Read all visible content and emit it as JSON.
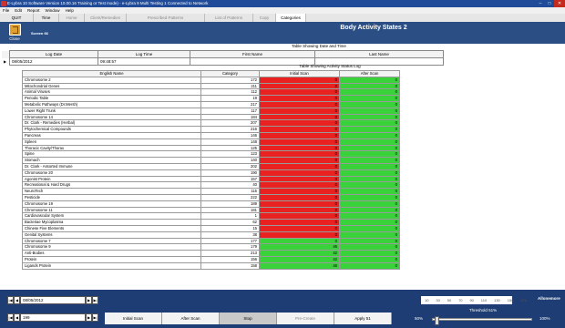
{
  "window": {
    "title": "E-Lybra 10 Software Version 10.00.16 Training or Test mode) - e-Lybra 9 Multi Testing 1 Connected to Network"
  },
  "menu": [
    "File",
    "Edit",
    "Report",
    "Window",
    "Help"
  ],
  "tabs": [
    {
      "label": "QUIT",
      "state": "normal"
    },
    {
      "label": "Time",
      "state": "normal"
    },
    {
      "label": "Home",
      "state": "disabled"
    },
    {
      "label": "Client/Remedies",
      "state": "disabled"
    },
    {
      "label": "Prescribed Patterns",
      "state": "disabled"
    },
    {
      "label": "List of Patterns",
      "state": "disabled"
    },
    {
      "label": "Copy",
      "state": "disabled"
    },
    {
      "label": "Categories",
      "state": "normal"
    }
  ],
  "header": {
    "close_label": "Close",
    "screen_id": "Screen 66",
    "title": "Body Activity States 2"
  },
  "date_section": {
    "caption": "Table Showing Date and Time",
    "headers": [
      "Log Date",
      "Log Time",
      "First Name",
      "Last Name"
    ],
    "row": [
      "08/05/2012",
      "09:48:57",
      "",
      ""
    ]
  },
  "status_section": {
    "caption": "Table Showing Activity Status Log",
    "headers": [
      "English Name",
      "Category",
      "Initial Scan",
      "After Scan"
    ],
    "rows": [
      {
        "name": "Chromosome 2",
        "cat": "172",
        "init": "0",
        "init_color": "red",
        "after": "0",
        "after_color": "green"
      },
      {
        "name": "Mitochondrial Genes",
        "cat": "211",
        "init": "0",
        "init_color": "red",
        "after": "0",
        "after_color": "green"
      },
      {
        "name": "Animal Viruses",
        "cat": "112",
        "init": "0",
        "init_color": "red",
        "after": "0",
        "after_color": "green"
      },
      {
        "name": "Periodic Table",
        "cat": "19",
        "init": "0",
        "init_color": "red",
        "after": "0",
        "after_color": "green"
      },
      {
        "name": "Metabolic Pathways (Dr.Mersh)",
        "cat": "217",
        "init": "0",
        "init_color": "red",
        "after": "0",
        "after_color": "green"
      },
      {
        "name": "Lower Right Trunk",
        "cat": "117",
        "init": "0",
        "init_color": "red",
        "after": "0",
        "after_color": "green"
      },
      {
        "name": "Chromosome 14",
        "cat": "184",
        "init": "0",
        "init_color": "red",
        "after": "0",
        "after_color": "green"
      },
      {
        "name": "Dr. Clark - Remedies (Herbal)",
        "cat": "207",
        "init": "0",
        "init_color": "red",
        "after": "0",
        "after_color": "green"
      },
      {
        "name": "Phytochemical Compounds",
        "cat": "216",
        "init": "0",
        "init_color": "red",
        "after": "0",
        "after_color": "green"
      },
      {
        "name": "Pancreas",
        "cat": "146",
        "init": "0",
        "init_color": "red",
        "after": "0",
        "after_color": "green"
      },
      {
        "name": "Spleen",
        "cat": "148",
        "init": "0",
        "init_color": "red",
        "after": "0",
        "after_color": "green"
      },
      {
        "name": "Thoracic Cavity/Thorax",
        "cat": "125",
        "init": "0",
        "init_color": "red",
        "after": "0",
        "after_color": "green"
      },
      {
        "name": "Spine",
        "cat": "123",
        "init": "0",
        "init_color": "red",
        "after": "0",
        "after_color": "green"
      },
      {
        "name": "Stomach",
        "cat": "140",
        "init": "0",
        "init_color": "red",
        "after": "0",
        "after_color": "green"
      },
      {
        "name": "Dr. Clark - Assorted Immune",
        "cat": "202",
        "init": "0",
        "init_color": "red",
        "after": "0",
        "after_color": "green"
      },
      {
        "name": "Chromosome 20",
        "cat": "190",
        "init": "0",
        "init_color": "red",
        "after": "0",
        "after_color": "green"
      },
      {
        "name": "Agonist Protein",
        "cat": "157",
        "init": "0",
        "init_color": "red",
        "after": "0",
        "after_color": "green"
      },
      {
        "name": "Recreational & Hard Drugs",
        "cat": "40",
        "init": "0",
        "init_color": "red",
        "after": "0",
        "after_color": "green"
      },
      {
        "name": "NeuroTech",
        "cat": "115",
        "init": "0",
        "init_color": "red",
        "after": "0",
        "after_color": "green"
      },
      {
        "name": "Pesticide",
        "cat": "222",
        "init": "0",
        "init_color": "red",
        "after": "0",
        "after_color": "green"
      },
      {
        "name": "Chromosome 19",
        "cat": "189",
        "init": "0",
        "init_color": "red",
        "after": "0",
        "after_color": "green"
      },
      {
        "name": "Chromosome 11",
        "cat": "181",
        "init": "0",
        "init_color": "red",
        "after": "0",
        "after_color": "green"
      },
      {
        "name": "Cardiovascular System",
        "cat": "1",
        "init": "0",
        "init_color": "red",
        "after": "0",
        "after_color": "green"
      },
      {
        "name": "Bacteriae Mycoplasma",
        "cat": "62",
        "init": "0",
        "init_color": "red",
        "after": "0",
        "after_color": "green"
      },
      {
        "name": "Chinese Five Elements",
        "cat": "15",
        "init": "0",
        "init_color": "red",
        "after": "0",
        "after_color": "green"
      },
      {
        "name": "Genital Systems",
        "cat": "38",
        "init": "0",
        "init_color": "red",
        "after": "0",
        "after_color": "green"
      },
      {
        "name": "Chromosome 7",
        "cat": "177",
        "init": "0",
        "init_color": "green",
        "after": "0",
        "after_color": "green"
      },
      {
        "name": "Chromosome 9",
        "cat": "179",
        "init": "46",
        "init_color": "green",
        "after": "0",
        "after_color": "green"
      },
      {
        "name": "Anti-Bodies",
        "cat": "213",
        "init": "42",
        "init_color": "green",
        "after": "0",
        "after_color": "green"
      },
      {
        "name": "Protein",
        "cat": "156",
        "init": "42",
        "init_color": "green",
        "after": "0",
        "after_color": "green"
      },
      {
        "name": "Ligands Protein",
        "cat": "158",
        "init": "46",
        "init_color": "green",
        "after": "0",
        "after_color": "green"
      }
    ]
  },
  "bottom": {
    "date_value": "08/05/2012",
    "index_value": "199",
    "scale": [
      "10",
      "30",
      "50",
      "70",
      "90",
      "110",
      "130",
      "150",
      "171"
    ],
    "allonemore_label": "Allonemore",
    "threshold_label": "Threshold 51%",
    "pct_min": "50%",
    "pct_max": "100%",
    "slider_level": 0.02,
    "buttons": [
      {
        "label": "Initial Scan",
        "state": "normal"
      },
      {
        "label": "After Scan",
        "state": "normal"
      },
      {
        "label": "Stop",
        "state": "selected"
      },
      {
        "label": "Pre-Create",
        "state": "disabled"
      },
      {
        "label": "Apply 51",
        "state": "normal"
      }
    ]
  },
  "colors": {
    "red": "#ea2121",
    "green": "#3ad23a",
    "header_bg": "#2b4f85",
    "bottom_bg": "#1d3d74"
  }
}
